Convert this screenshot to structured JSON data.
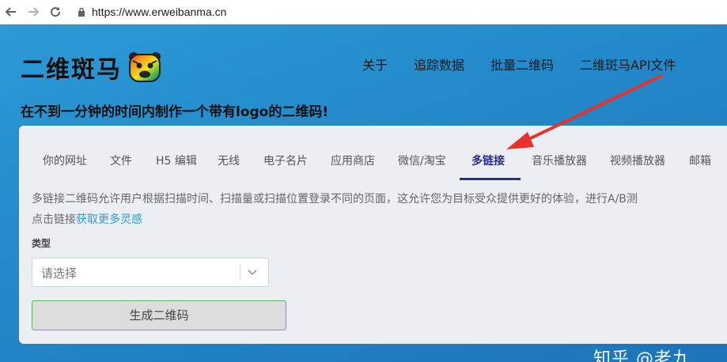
{
  "browser": {
    "url": "https://www.erweibanma.cn"
  },
  "header": {
    "logo_text": "二维斑马",
    "nav": [
      "关于",
      "追踪数据",
      "批量二维码",
      "二维斑马API文件"
    ],
    "tagline": "在不到一分钟的时间内制作一个带有logo的二维码!"
  },
  "tabs": [
    {
      "label": "你的网址"
    },
    {
      "label": "文件"
    },
    {
      "label": "H5 编辑"
    },
    {
      "label": "无线"
    },
    {
      "label": "电子名片"
    },
    {
      "label": "应用商店"
    },
    {
      "label": "微信/淘宝"
    },
    {
      "label": "多链接",
      "active": true
    },
    {
      "label": "音乐播放器"
    },
    {
      "label": "视频播放器"
    },
    {
      "label": "邮箱"
    }
  ],
  "content": {
    "description_line1": "多链接二维码允许用户根据扫描时间、扫描量或扫描位置登录不同的页面，这允许您为目标受众提供更好的体验，进行A/B测",
    "description_line2_prefix": "点击链接",
    "description_link": "获取更多灵感",
    "type_label": "类型",
    "select_placeholder": "请选择",
    "generate_button": "生成二维码"
  },
  "watermark": "知乎 @老九",
  "colors": {
    "page_bg": "#2288c9",
    "panel_bg": "#ebeef2",
    "active_tab": "#2b2f8a",
    "link": "#2b9fd5",
    "button_border": "#5cb85c",
    "annotation_arrow": "#e8322a"
  }
}
